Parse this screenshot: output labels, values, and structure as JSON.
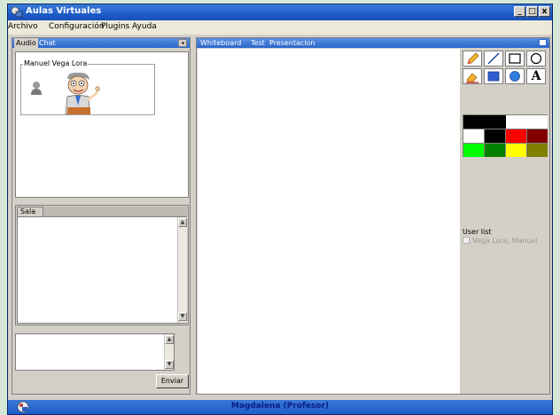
{
  "window": {
    "title": "Aulas Virtuales",
    "btn_min": "_",
    "btn_max": "□",
    "btn_close": "x"
  },
  "menu": [
    "Archivo",
    "Configuración",
    "Plugins",
    "Ayuda"
  ],
  "left_panel": {
    "tabs": [
      "Audio",
      "Chat"
    ],
    "collapse_glyph": "◂",
    "user_card_name": "Manuel Vega Lora",
    "sala_tab": "Sala",
    "send_button": "Enviar"
  },
  "right_panel": {
    "tabs": [
      "Whiteboard",
      "Test",
      "Presentacion"
    ],
    "tools": [
      "pencil-icon",
      "line-icon",
      "rectangle-icon",
      "ellipse-icon",
      "eraser-icon",
      "filled-rectangle-icon",
      "filled-ellipse-icon",
      "text-tool-icon"
    ],
    "text_tool_glyph": "A",
    "palette_top": [
      "#000000",
      "#ffffff"
    ],
    "palette_colors": [
      "#ffffff",
      "#000000",
      "#ff0000",
      "#800000",
      "#00ff00",
      "#008000",
      "#ffff00",
      "#808000"
    ],
    "user_list_title": "User list",
    "user_list": [
      "Vega Lora, Manuel"
    ]
  },
  "status": {
    "text": "Magdalena   (Profesor)"
  }
}
